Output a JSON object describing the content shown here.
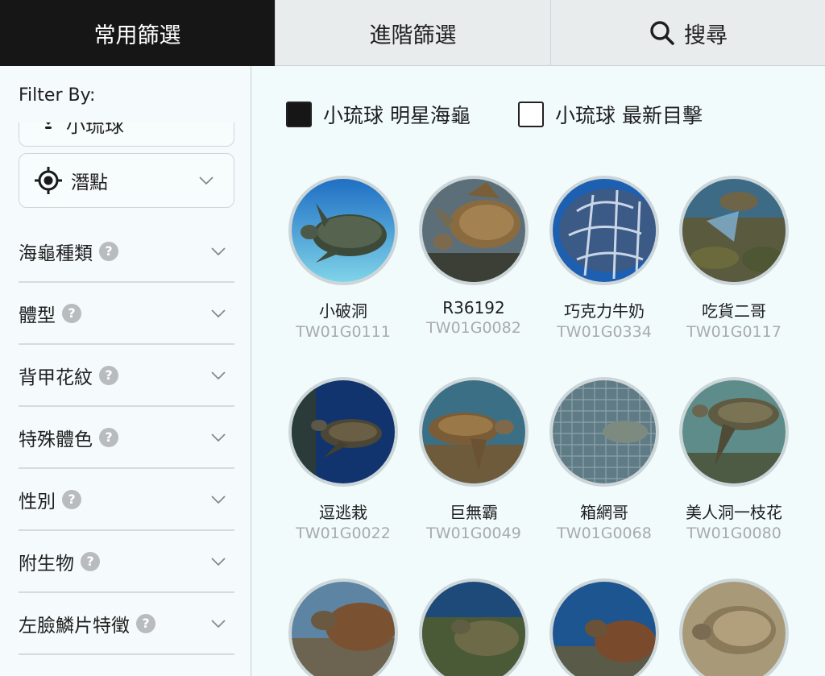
{
  "tabs": [
    {
      "label": "常用篩選",
      "active": true
    },
    {
      "label": "進階篩選",
      "active": false
    },
    {
      "label": "搜尋",
      "active": false,
      "icon": "search-icon"
    }
  ],
  "sidebar": {
    "title": "Filter By:",
    "partial_select": {
      "label": "小琉球",
      "icon": "location-pin-icon"
    },
    "spot_select": {
      "label": "潛點",
      "icon": "crosshair-target-icon"
    },
    "filters": [
      {
        "label": "海龜種類",
        "help": "?"
      },
      {
        "label": "體型",
        "help": "?"
      },
      {
        "label": "背甲花紋",
        "help": "?"
      },
      {
        "label": "特殊體色",
        "help": "?"
      },
      {
        "label": "性別",
        "help": "?"
      },
      {
        "label": "附生物",
        "help": "?"
      },
      {
        "label": "左臉鱗片特徵",
        "help": "?"
      }
    ]
  },
  "main": {
    "checkboxes": [
      {
        "label": "小琉球 明星海龜",
        "checked": true
      },
      {
        "label": "小琉球 最新目擊",
        "checked": false
      }
    ],
    "turtles": [
      {
        "name": "小破洞",
        "id": "TW01G0111"
      },
      {
        "name": "R36192",
        "id": "TW01G0082"
      },
      {
        "name": "巧克力牛奶",
        "id": "TW01G0334"
      },
      {
        "name": "吃貨二哥",
        "id": "TW01G0117"
      },
      {
        "name": "逗逃栽",
        "id": "TW01G0022"
      },
      {
        "name": "巨無霸",
        "id": "TW01G0049"
      },
      {
        "name": "箱網哥",
        "id": "TW01G0068"
      },
      {
        "name": "美人洞一枝花",
        "id": "TW01G0080"
      },
      {
        "name": "",
        "id": ""
      },
      {
        "name": "",
        "id": ""
      },
      {
        "name": "",
        "id": ""
      },
      {
        "name": "",
        "id": ""
      }
    ]
  },
  "colors": {
    "active_tab": "#161616",
    "tab_bg": "#e9eced",
    "panel_bg": "#f2fbfc",
    "id_text": "#a7abad",
    "help_badge": "#b9bcbe"
  }
}
